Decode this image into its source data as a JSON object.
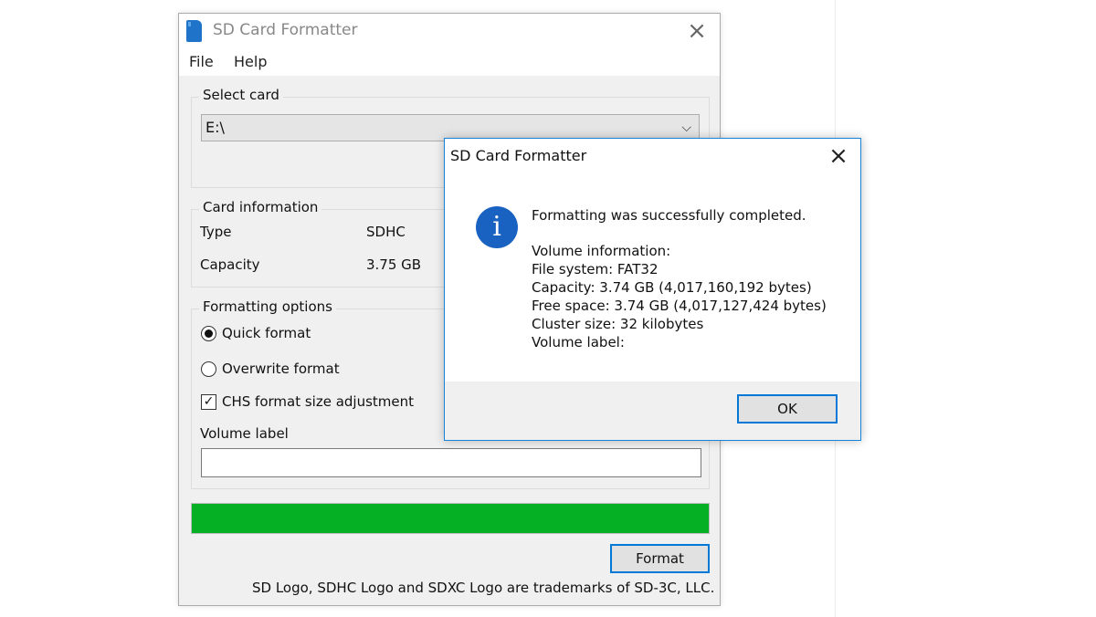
{
  "main_window": {
    "title": "SD Card Formatter",
    "icons": {
      "app": "sd-card-icon",
      "close": "close-icon"
    },
    "menu": [
      "File",
      "Help"
    ],
    "select_card": {
      "legend": "Select card",
      "value": "E:\\"
    },
    "card_info": {
      "legend": "Card information",
      "type_label": "Type",
      "type_value": "SDHC",
      "capacity_label": "Capacity",
      "capacity_value": "3.75 GB"
    },
    "formatting_options": {
      "legend": "Formatting options",
      "quick_format": "Quick format",
      "overwrite_format": "Overwrite format",
      "chs_adjustment": "CHS format size adjustment",
      "volume_label_caption": "Volume label",
      "volume_label_value": ""
    },
    "progress": {
      "percent": 100,
      "color": "#06b025"
    },
    "format_button": "Format",
    "trademark": "SD Logo, SDHC Logo and SDXC Logo are trademarks of SD-3C, LLC."
  },
  "dialog": {
    "title": "SD Card Formatter",
    "icon": "info-icon",
    "message": "Formatting was successfully completed.",
    "volume_info_title": "Volume information:",
    "file_system": "File system: FAT32",
    "capacity": "Capacity: 3.74 GB (4,017,160,192 bytes)",
    "free_space": "Free space: 3.74 GB (4,017,127,424 bytes)",
    "cluster_size": "Cluster size: 32 kilobytes",
    "volume_label": "Volume label:",
    "ok_button": "OK"
  },
  "colors": {
    "accent": "#0078d7",
    "progress_green": "#06b025",
    "info_blue": "#1a62c2"
  }
}
